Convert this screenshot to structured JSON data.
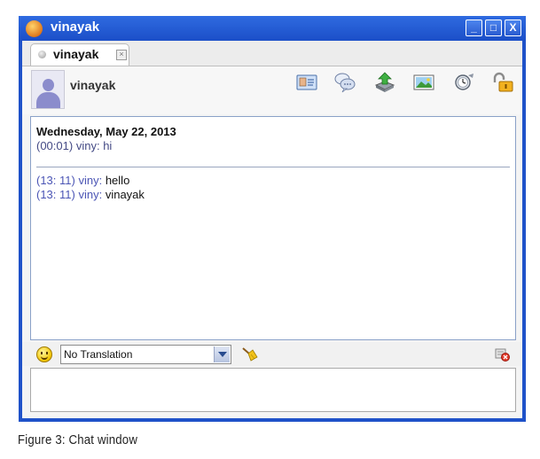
{
  "window": {
    "title": "vinayak",
    "controls": {
      "minimize": "_",
      "maximize": "□",
      "close": "X"
    }
  },
  "tab": {
    "label": "vinayak",
    "close": "×"
  },
  "contact": {
    "name": "vinayak"
  },
  "toolbar": {
    "icons": [
      "contact-card-icon",
      "chat-bubbles-icon",
      "file-transfer-icon",
      "image-icon",
      "timer-icon",
      "unlock-icon"
    ]
  },
  "chat": {
    "date": "Wednesday, May 22, 2013",
    "history": [
      {
        "time": "(00:01)",
        "sender": "viny:",
        "text": "hi"
      }
    ],
    "messages": [
      {
        "time": "(13: 11)",
        "sender": "viny:",
        "text": "hello"
      },
      {
        "time": "(13: 11)",
        "sender": "viny:",
        "text": "vinayak"
      }
    ]
  },
  "translation": {
    "selected": "No Translation"
  },
  "input": {
    "value": ""
  },
  "caption": "Figure 3: Chat window",
  "colors": {
    "title_bar": "#1f52c9",
    "timestamp": "#4b55b5"
  }
}
